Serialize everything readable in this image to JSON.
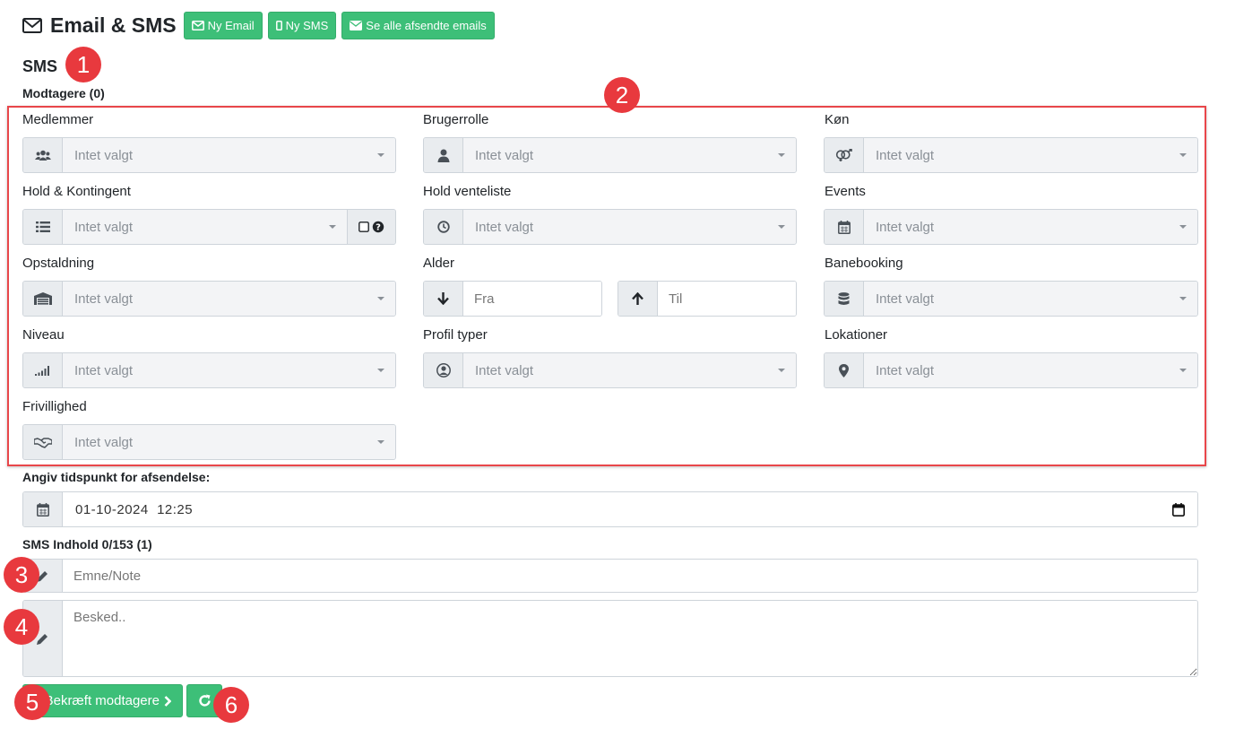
{
  "header": {
    "title": "Email & SMS",
    "buttons": {
      "new_email": "Ny Email",
      "new_sms": "Ny SMS",
      "see_sent": "Se alle afsendte emails"
    }
  },
  "section_title": "SMS",
  "recipients_label": "Modtagere (0)",
  "filters": {
    "members": {
      "label": "Medlemmer",
      "value": "Intet valgt",
      "icon": "users-icon"
    },
    "user_role": {
      "label": "Brugerrolle",
      "value": "Intet valgt",
      "icon": "user-icon"
    },
    "gender": {
      "label": "Køn",
      "value": "Intet valgt",
      "icon": "gender-icon"
    },
    "team": {
      "label": "Hold & Kontingent",
      "value": "Intet valgt",
      "icon": "list-icon"
    },
    "team_waitlist": {
      "label": "Hold venteliste",
      "value": "Intet valgt",
      "icon": "clock-icon"
    },
    "events": {
      "label": "Events",
      "value": "Intet valgt",
      "icon": "calendar-icon"
    },
    "stabling": {
      "label": "Opstaldning",
      "value": "Intet valgt",
      "icon": "warehouse-icon"
    },
    "age": {
      "label": "Alder",
      "from_placeholder": "Fra",
      "to_placeholder": "Til"
    },
    "court_booking": {
      "label": "Banebooking",
      "value": "Intet valgt",
      "icon": "database-icon"
    },
    "level": {
      "label": "Niveau",
      "value": "Intet valgt",
      "icon": "signal-icon"
    },
    "profile_types": {
      "label": "Profil typer",
      "value": "Intet valgt",
      "icon": "user-circle-icon"
    },
    "locations": {
      "label": "Lokationer",
      "value": "Intet valgt",
      "icon": "map-marker-icon"
    },
    "volunteering": {
      "label": "Frivillighed",
      "value": "Intet valgt",
      "icon": "handshake-icon"
    }
  },
  "schedule": {
    "label": "Angiv tidspunkt for afsendelse:",
    "value": "01-10-2024  12:25"
  },
  "content": {
    "label": "SMS Indhold 0/153 (1)",
    "subject_placeholder": "Emne/Note",
    "message_placeholder": "Besked.."
  },
  "actions": {
    "confirm_label": "Bekræft modtagere"
  },
  "annotations": [
    "1",
    "2",
    "3",
    "4",
    "5",
    "6"
  ],
  "colors": {
    "green": "#3dbf78",
    "red_annotation": "#e8393e"
  }
}
